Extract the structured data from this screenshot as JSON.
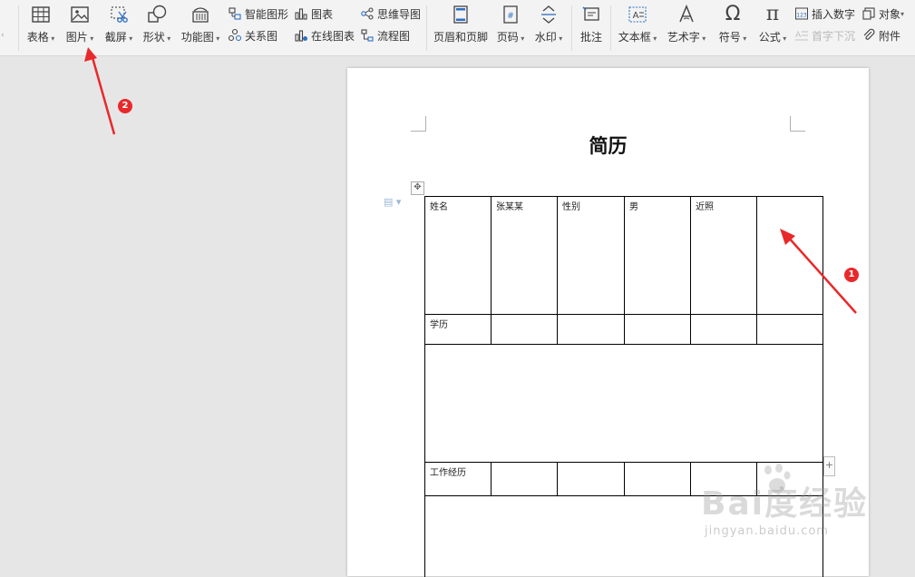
{
  "toolbar": {
    "groups": [
      {
        "items": [
          {
            "label": "表格",
            "icon": "table-icon"
          },
          {
            "label": "图片",
            "icon": "picture-icon"
          },
          {
            "label": "截屏",
            "icon": "screenshot-icon"
          },
          {
            "label": "形状",
            "icon": "shapes-icon"
          },
          {
            "label": "功能图",
            "icon": "function-chart-icon"
          }
        ]
      },
      {
        "small_items": [
          {
            "label": "智能图形",
            "icon": "smart-art-icon"
          },
          {
            "label": "图表",
            "icon": "bar-chart-icon"
          },
          {
            "label": "思维导图",
            "icon": "mind-map-icon"
          },
          {
            "label": "关系图",
            "icon": "relation-chart-icon"
          },
          {
            "label": "在线图表",
            "icon": "online-chart-icon"
          },
          {
            "label": "流程图",
            "icon": "flowchart-icon"
          }
        ]
      }
    ],
    "header_footer": "页眉和页脚",
    "page_number": "页码",
    "watermark": "水印",
    "comment": "批注",
    "text_box": "文本框",
    "word_art": "艺术字",
    "symbol": "符号",
    "formula": "公式",
    "insert_number": "插入数字",
    "object": "对象",
    "drop_cap": "首字下沉",
    "attachment": "附件"
  },
  "document": {
    "title": "简历",
    "table": {
      "row1": [
        "姓名",
        "张某某",
        "性别",
        "男",
        "近照",
        ""
      ],
      "row2_label": "学历",
      "row4_label": "工作经历"
    }
  },
  "annotations": {
    "badge1": "1",
    "badge2": "2",
    "arrow_color": "#e8292b"
  },
  "watermark_text": {
    "brand": "Bai度经验",
    "site": "jingyan.baidu.com"
  }
}
